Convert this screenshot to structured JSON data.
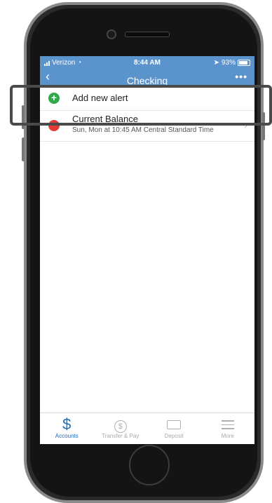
{
  "status_bar": {
    "carrier": "Verizon",
    "time": "8:44 AM",
    "battery": "93%"
  },
  "nav": {
    "title": "Checking"
  },
  "alerts": {
    "add_label": "Add new alert",
    "items": [
      {
        "title": "Current Balance",
        "schedule": "Sun, Mon at 10:45 AM Central Standard Time"
      }
    ]
  },
  "tabs": [
    {
      "label": "Accounts",
      "icon": "dollar-icon",
      "active": true
    },
    {
      "label": "Transfer & Pay",
      "icon": "transfer-icon",
      "active": false
    },
    {
      "label": "Deposit",
      "icon": "check-deposit-icon",
      "active": false
    },
    {
      "label": "More",
      "icon": "menu-icon",
      "active": false
    }
  ],
  "colors": {
    "header": "#5b93cd",
    "accent": "#1d6fbf",
    "add": "#2eaa4a",
    "remove": "#e53935"
  }
}
